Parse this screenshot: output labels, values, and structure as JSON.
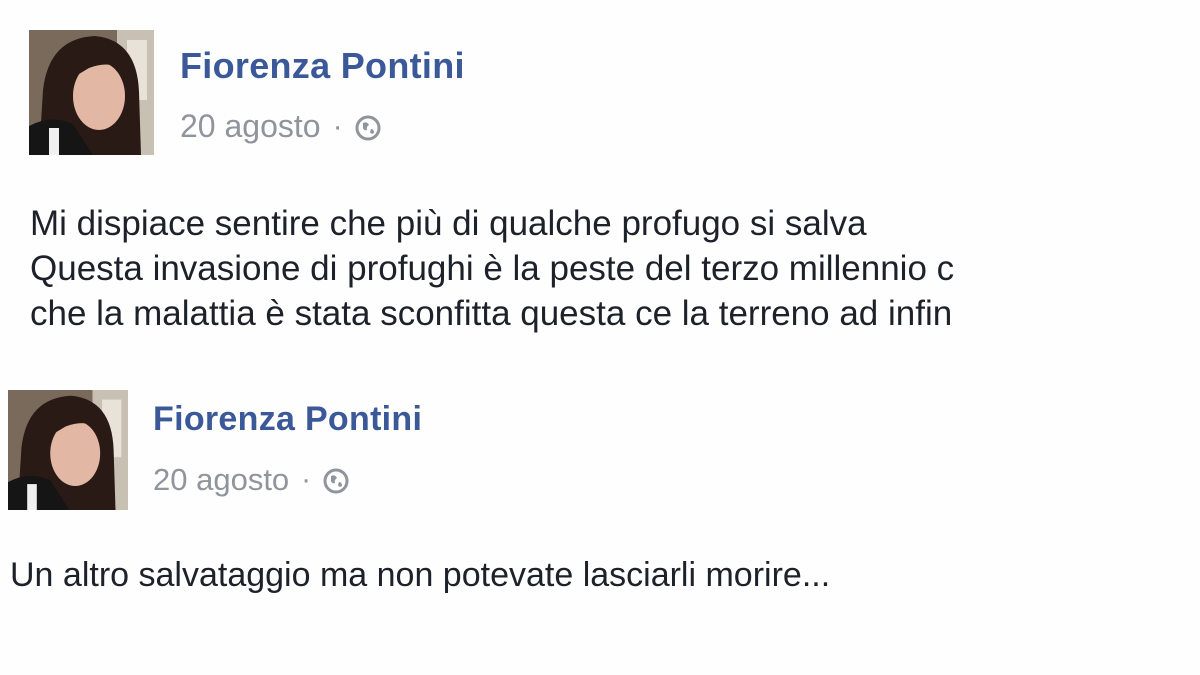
{
  "posts": [
    {
      "author": "Fiorenza Pontini",
      "date": "20 agosto",
      "separator": "·",
      "audience_icon": "globe-icon",
      "lines": [
        "Mi dispiace sentire che più di qualche profugo si salva",
        "Questa invasione di profughi è la peste del terzo millennio c",
        "che la malattia è stata sconfitta questa ce la terreno ad infin"
      ]
    },
    {
      "author": "Fiorenza Pontini",
      "date": "20 agosto",
      "separator": "·",
      "audience_icon": "globe-icon",
      "lines": [
        "Un altro salvataggio ma non potevate lasciarli morire..."
      ]
    }
  ],
  "colors": {
    "author": "#3b5998",
    "meta": "#90949c",
    "text": "#1d2129",
    "background": "#fefefe"
  }
}
